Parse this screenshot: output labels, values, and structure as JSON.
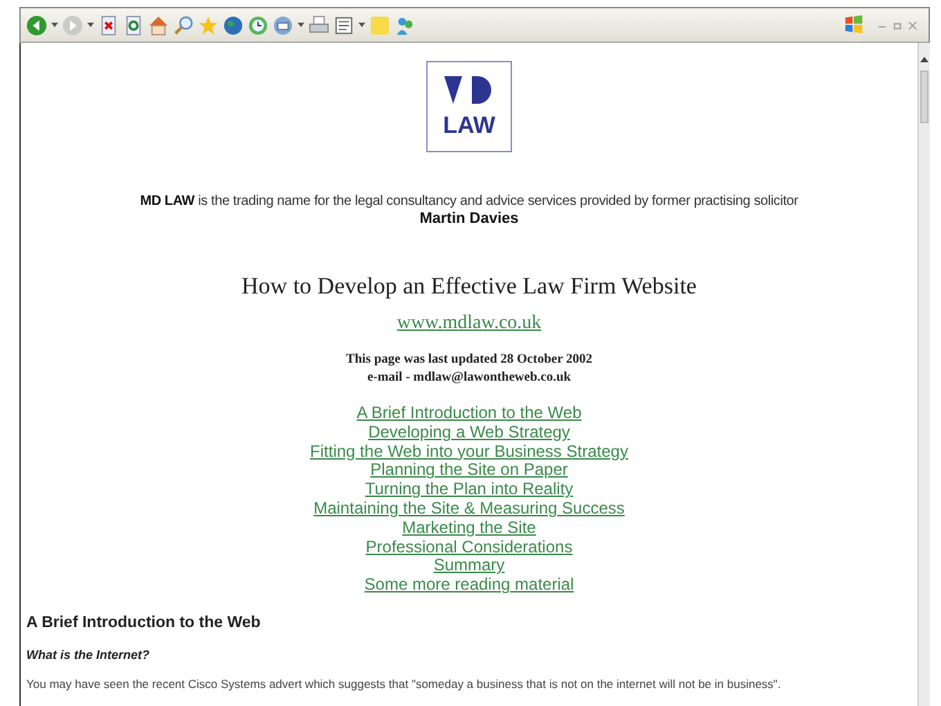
{
  "logo": {
    "text": "LAW"
  },
  "intro": {
    "text": "**MD LAW** is the trading name for the legal consultancy and advice services provided by former practising solicitor",
    "name": "Martin Davies"
  },
  "title": "How to Develop an Effective Law Firm Website",
  "site_link": "www.mdlaw.co.uk",
  "updated": "This page was last updated 28 October 2002",
  "email": "e-mail - mdlaw@lawontheweb.co.uk",
  "contents": [
    {
      "label": "A Brief Introduction to the Web"
    },
    {
      "label": "Developing a Web Strategy"
    },
    {
      "label": "Fitting the Web into your Business Strategy"
    },
    {
      "label": "Planning the Site on Paper"
    },
    {
      "label": "Turning the Plan into Reality"
    },
    {
      "label": "Maintaining the Site & Measuring Success"
    },
    {
      "label": "Marketing the Site"
    },
    {
      "label": "Professional Considerations"
    },
    {
      "label": "Summary"
    },
    {
      "label": "Some more reading material"
    }
  ],
  "section_heading": "A Brief Introduction to the Web",
  "subheading": "What is the Internet?",
  "body": "You may have seen the recent Cisco Systems advert which suggests that \"someday a business that is not on the internet will not be in business\"."
}
